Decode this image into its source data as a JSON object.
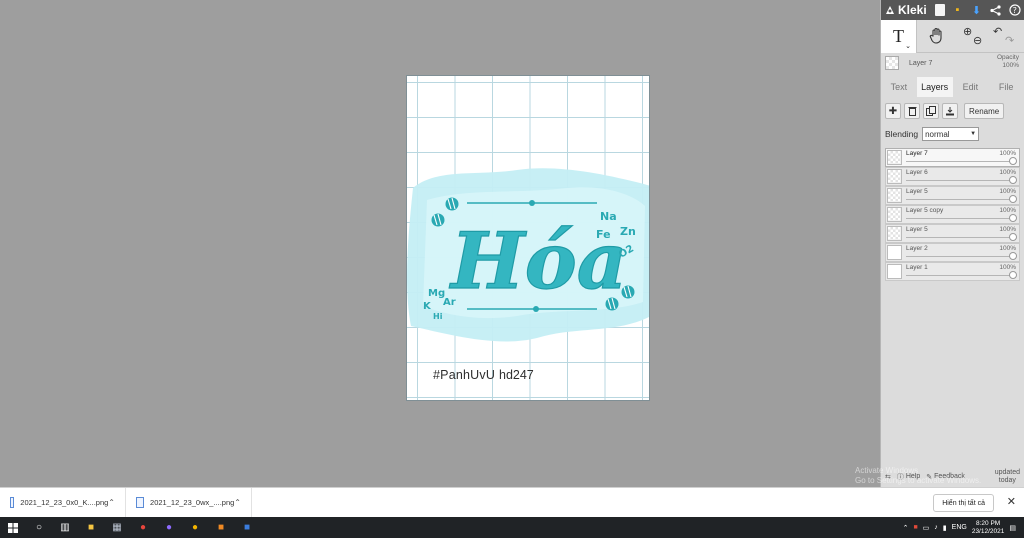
{
  "app": {
    "name": "Kleki"
  },
  "canvas": {
    "hashtag": "#PanhUvU",
    "code": "hd247",
    "title_text": "Hóa",
    "elements_left": [
      "Mg",
      "K",
      "Ar",
      "Hi"
    ],
    "elements_right": [
      "Na",
      "Fe",
      "Zn",
      "O₂"
    ],
    "colors": {
      "teal": "#2fb4bf",
      "teal_dark": "#1e9aa6",
      "splash": "#bfeef4"
    }
  },
  "toolbar": {
    "text_tool": "T",
    "caret": "⌄",
    "icons": [
      "text-tool-icon",
      "hand-icon",
      "zoom-in-icon",
      "zoom-out-icon",
      "undo-icon",
      "redo-icon"
    ]
  },
  "layer_header": {
    "current_layer": "Layer 7",
    "opacity_label": "Opacity",
    "opacity_value": "100%"
  },
  "tabs": [
    {
      "label": "Text",
      "active": false
    },
    {
      "label": "Layers",
      "active": true
    },
    {
      "label": "Edit",
      "active": false
    },
    {
      "label": "File",
      "active": false
    }
  ],
  "actions": {
    "rename": "Rename"
  },
  "blending": {
    "label": "Blending",
    "value": "normal"
  },
  "layers": [
    {
      "name": "Layer 7",
      "opacity": "100%",
      "selected": true,
      "thumb": "checker"
    },
    {
      "name": "Layer 6",
      "opacity": "100%",
      "selected": false,
      "thumb": "checker"
    },
    {
      "name": "Layer 5",
      "opacity": "100%",
      "selected": false,
      "thumb": "checker"
    },
    {
      "name": "Layer 5 copy",
      "opacity": "100%",
      "selected": false,
      "thumb": "checker"
    },
    {
      "name": "Layer 5",
      "opacity": "100%",
      "selected": false,
      "thumb": "checker"
    },
    {
      "name": "Layer 2",
      "opacity": "100%",
      "selected": false,
      "thumb": "white"
    },
    {
      "name": "Layer 1",
      "opacity": "100%",
      "selected": false,
      "thumb": "white"
    }
  ],
  "footer": {
    "help": "Help",
    "feedback": "Feedback",
    "updated_line1": "updated",
    "updated_line2": "today"
  },
  "watermark": {
    "line1": "Activate Windows",
    "line2": "Go to Settings to activate Windows."
  },
  "downloads": {
    "files": [
      "2021_12_23_0x0_K....png",
      "2021_12_23_0wx_....png"
    ],
    "show_all": "Hiển thị tất cả"
  },
  "taskbar": {
    "lang": "ENG",
    "time": "8:20 PM",
    "date": "23/12/2021"
  }
}
